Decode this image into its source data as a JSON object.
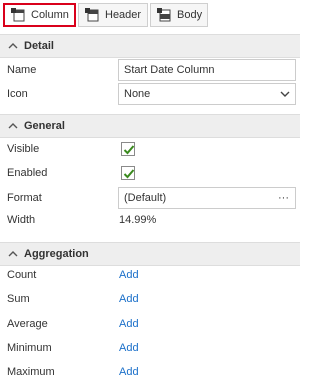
{
  "tabs": [
    {
      "label": "Column",
      "active": true
    },
    {
      "label": "Header",
      "active": false
    },
    {
      "label": "Body",
      "active": false
    }
  ],
  "sections": {
    "detail": {
      "title": "Detail",
      "name_label": "Name",
      "name_value": "Start Date Column",
      "icon_label": "Icon",
      "icon_value": "None"
    },
    "general": {
      "title": "General",
      "visible_label": "Visible",
      "visible_checked": true,
      "enabled_label": "Enabled",
      "enabled_checked": true,
      "format_label": "Format",
      "format_value": "(Default)",
      "format_button": "···",
      "width_label": "Width",
      "width_value": "14.99%"
    },
    "aggregation": {
      "title": "Aggregation",
      "items": [
        {
          "label": "Count",
          "action": "Add"
        },
        {
          "label": "Sum",
          "action": "Add"
        },
        {
          "label": "Average",
          "action": "Add"
        },
        {
          "label": "Minimum",
          "action": "Add"
        },
        {
          "label": "Maximum",
          "action": "Add"
        }
      ]
    }
  },
  "colors": {
    "active_tab_border": "#d9001b",
    "link": "#1a6fc9",
    "check": "#3a8a1e"
  }
}
